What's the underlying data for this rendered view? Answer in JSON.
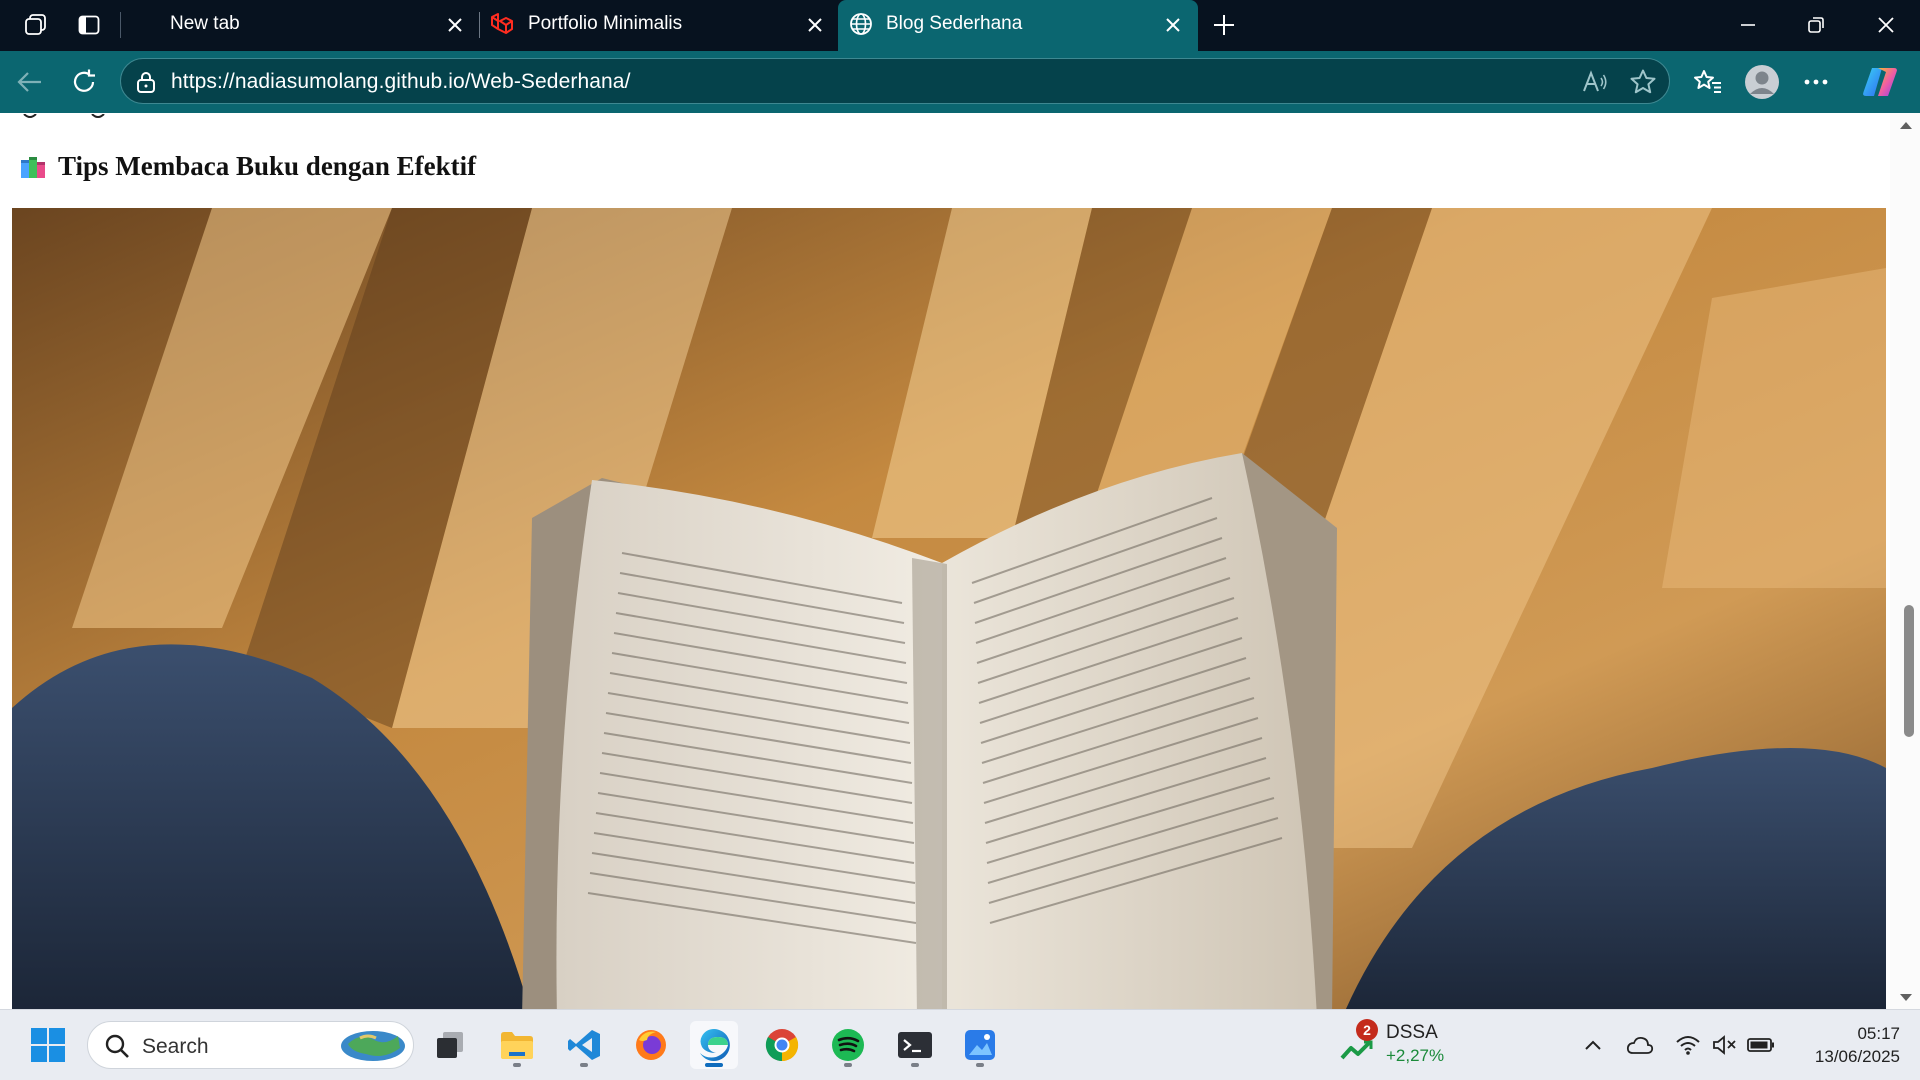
{
  "browser": {
    "tabs": [
      {
        "label": "New tab",
        "active": false,
        "icon": "workspaces-icon"
      },
      {
        "label": "Portfolio Minimalis",
        "active": false,
        "icon": "laravel-icon"
      },
      {
        "label": "Blog Sederhana",
        "active": true,
        "icon": "globe-icon"
      }
    ],
    "url": "https://nadiasumolang.github.io/Web-Sederhana/",
    "accent_color": "#0b6670",
    "titlebar_color": "#07121f"
  },
  "page": {
    "heading_emoji": "books-icon",
    "heading": "Tips Membaca Buku dengan Efektif",
    "image": "open-book-photo"
  },
  "taskbar": {
    "search_placeholder": "Search",
    "apps": [
      "start-icon",
      "task-view-icon",
      "file-explorer-icon",
      "vscode-icon",
      "firefox-icon",
      "edge-icon",
      "chrome-icon",
      "spotify-icon",
      "terminal-icon",
      "paint-icon"
    ],
    "stock": {
      "badge": "2",
      "name": "DSSA",
      "change": "+2,27%"
    },
    "time": "05:17",
    "date": "13/06/2025"
  }
}
